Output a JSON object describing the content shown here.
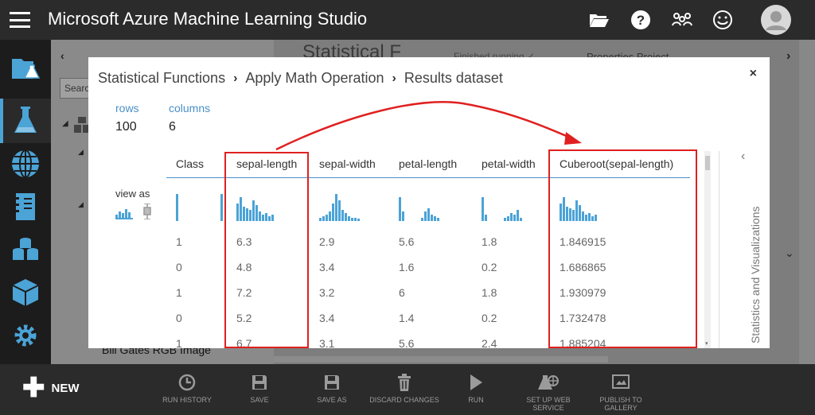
{
  "app": {
    "title": "Microsoft Azure Machine Learning Studio"
  },
  "background": {
    "search_placeholder": "Search",
    "canvas_title": "Statistical F",
    "status": "Finished running ✓",
    "properties": "Properties   Project",
    "bottom_list_item": "Bill Gates RGB Image"
  },
  "modal": {
    "breadcrumb": [
      "Statistical Functions",
      "Apply Math Operation",
      "Results dataset"
    ],
    "close": "×",
    "rows_label": "rows",
    "rows_value": "100",
    "columns_label": "columns",
    "columns_value": "6",
    "view_as": "view as",
    "stats_panel_label": "Statistics and Visualizations",
    "table": {
      "columns": [
        "Class",
        "sepal-length",
        "sepal-width",
        "petal-length",
        "petal-width",
        "Cuberoot(sepal-length)"
      ],
      "rows": [
        [
          "1",
          "6.3",
          "2.9",
          "5.6",
          "1.8",
          "1.846915"
        ],
        [
          "0",
          "4.8",
          "3.4",
          "1.6",
          "0.2",
          "1.686865"
        ],
        [
          "1",
          "7.2",
          "3.2",
          "6",
          "1.8",
          "1.930979"
        ],
        [
          "0",
          "5.2",
          "3.4",
          "1.4",
          "0.2",
          "1.732478"
        ],
        [
          "1",
          "6.7",
          "3.1",
          "5.6",
          "2.4",
          "1.885204"
        ]
      ]
    }
  },
  "bottom_bar": {
    "new": "NEW",
    "actions": [
      {
        "label": "RUN HISTORY",
        "icon": "clock-icon"
      },
      {
        "label": "SAVE",
        "icon": "save-icon"
      },
      {
        "label": "SAVE AS",
        "icon": "save-as-icon"
      },
      {
        "label": "DISCARD CHANGES",
        "icon": "trash-icon"
      },
      {
        "label": "RUN",
        "icon": "play-icon"
      },
      {
        "label": "SET UP WEB SERVICE",
        "icon": "web-service-icon"
      },
      {
        "label": "PUBLISH TO GALLERY",
        "icon": "publish-icon"
      }
    ]
  },
  "colors": {
    "accent": "#4ba3d6",
    "annotation": "#e02020",
    "topbar": "#2b2b2b"
  }
}
